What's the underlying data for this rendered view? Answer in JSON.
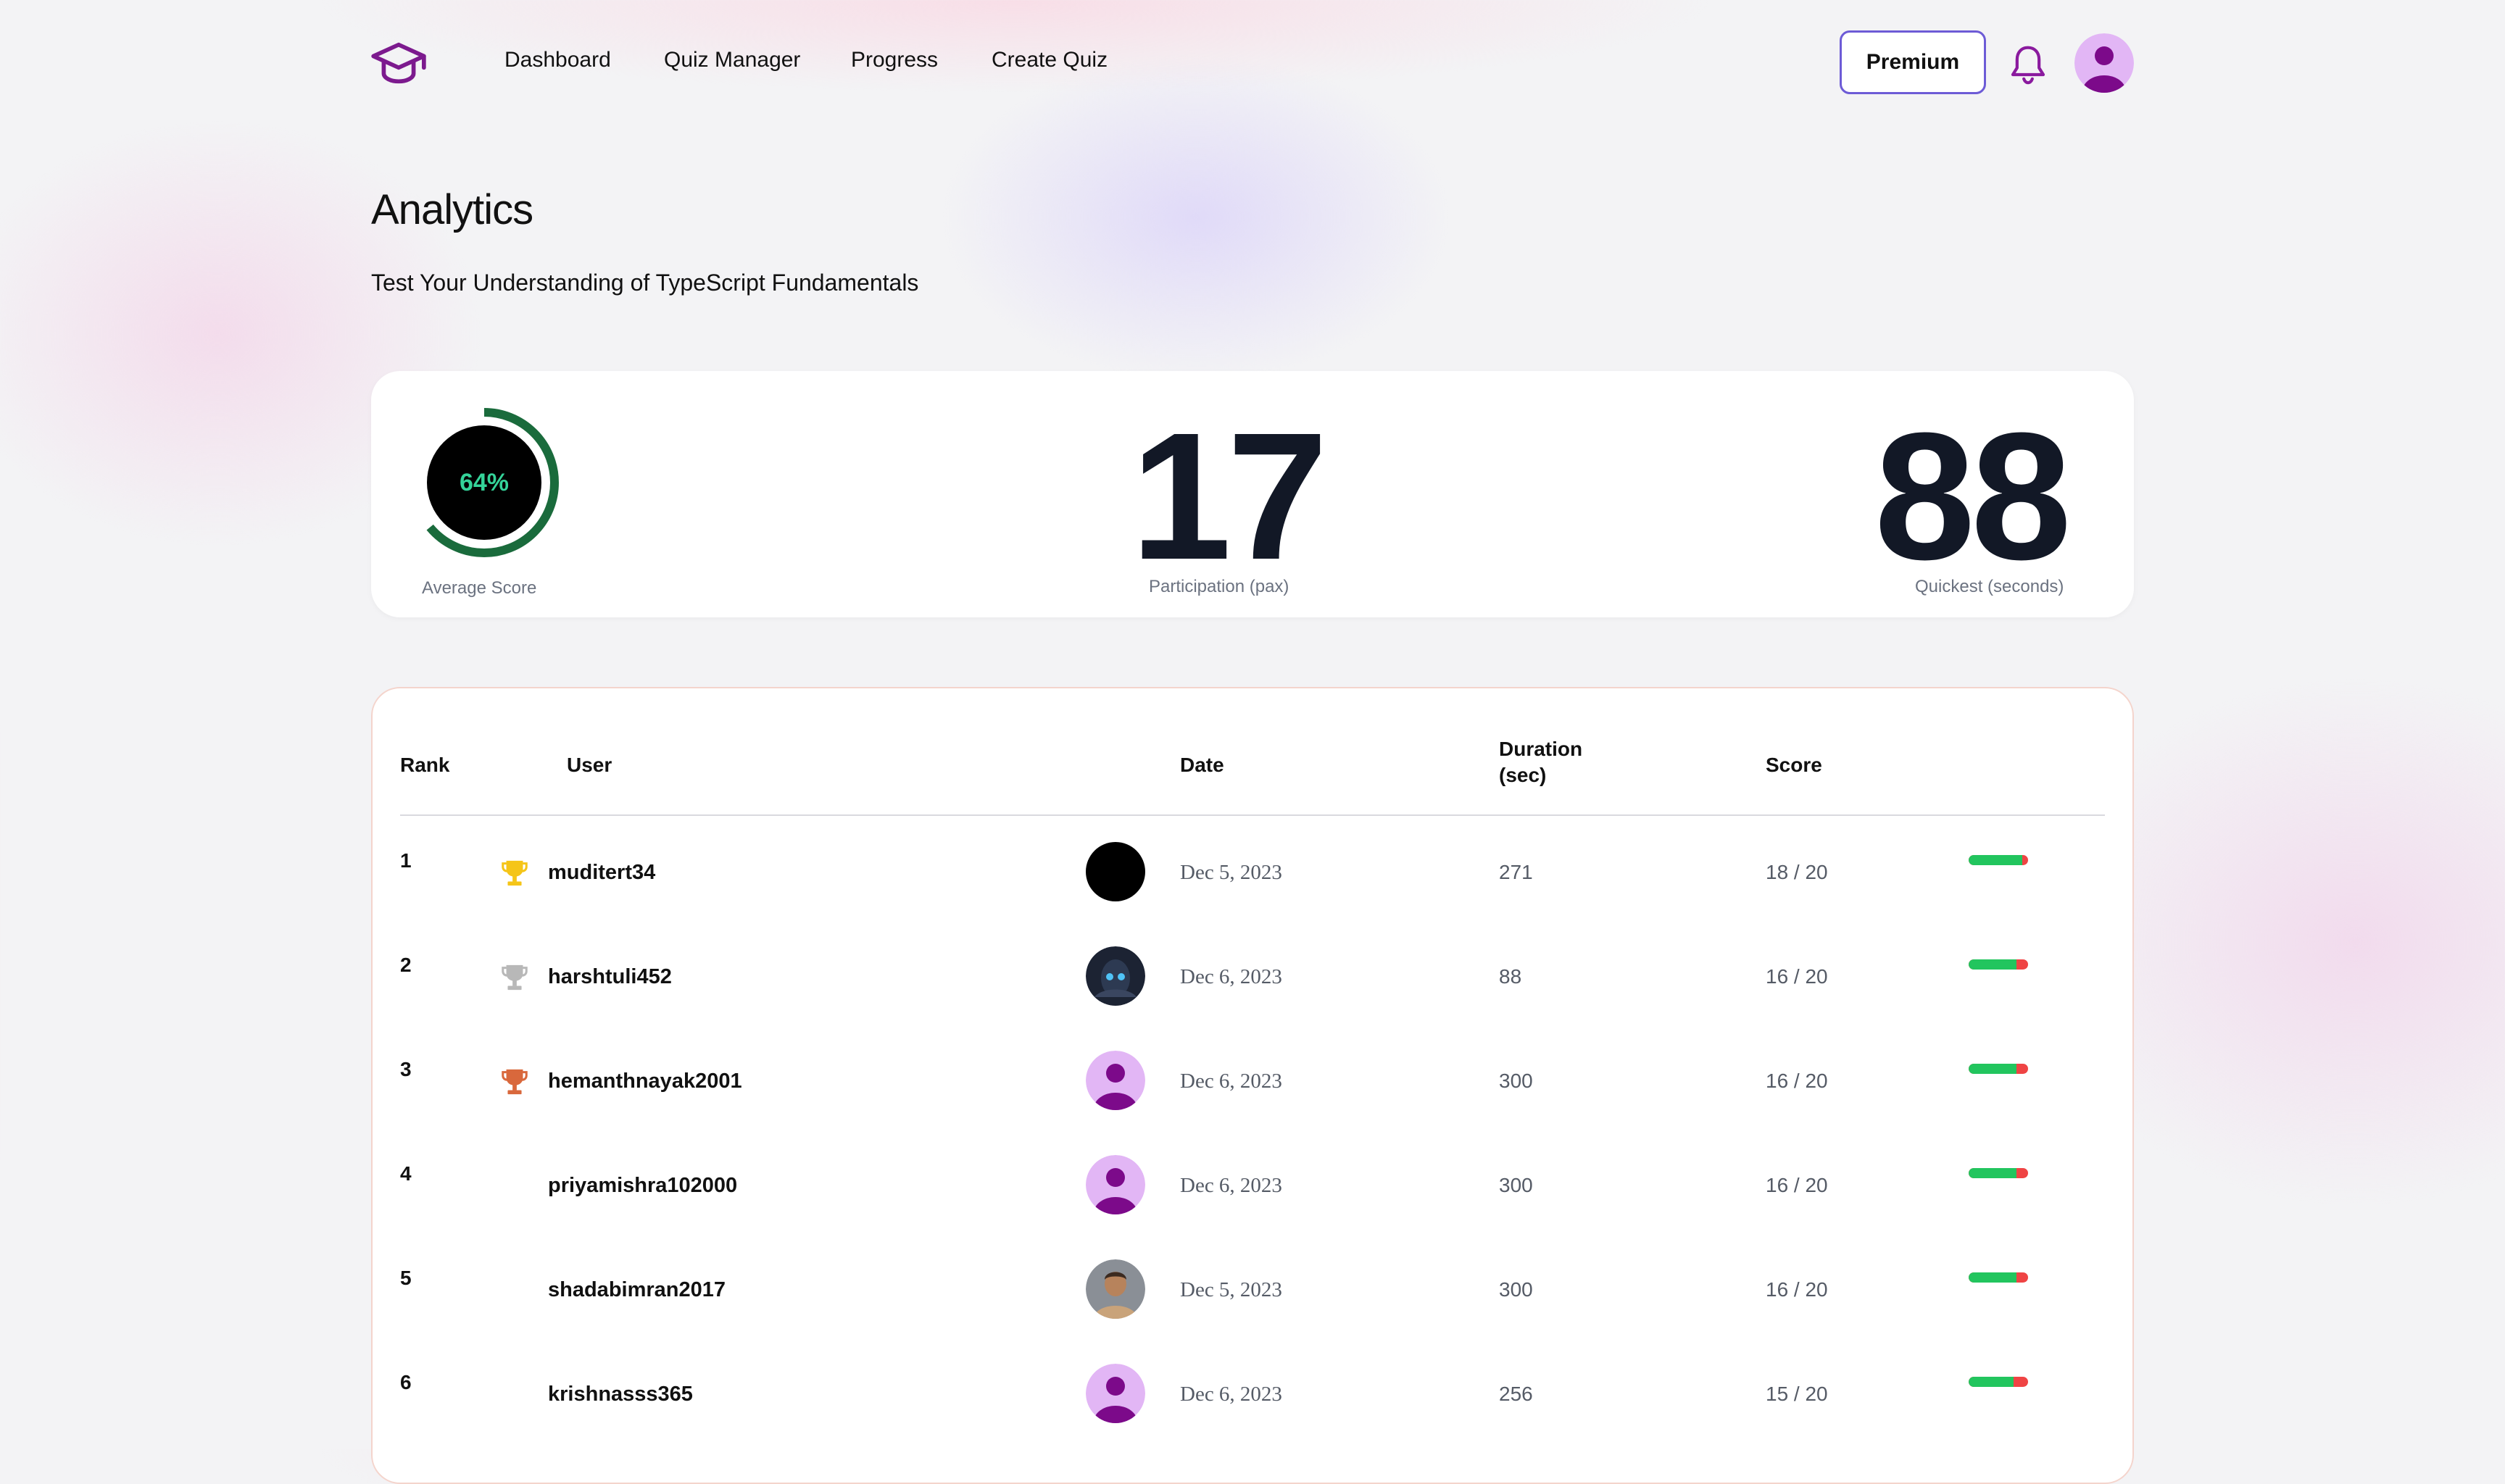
{
  "header": {
    "nav": [
      "Dashboard",
      "Quiz Manager",
      "Progress",
      "Create Quiz"
    ],
    "premium_label": "Premium"
  },
  "page": {
    "title": "Analytics",
    "subtitle": "Test Your Understanding of TypeScript Fundamentals"
  },
  "stats": {
    "average_score_value": 0.64,
    "average_score_text": "64%",
    "average_score_label": "Average Score",
    "participation": "17",
    "participation_label": "Participation (pax)",
    "quickest": "88",
    "quickest_label": "Quickest (seconds)"
  },
  "colors": {
    "accent": "#6d5bd6",
    "gauge_ring": "#1a6b3c",
    "gauge_text": "#34d399",
    "bar_green": "#22c55e",
    "bar_red": "#ef4444",
    "trophy_gold": "#f5c518",
    "trophy_silver": "#b8b8b8",
    "trophy_bronze": "#d9683c",
    "avatar_bg": "#e2b6f5",
    "avatar_fg": "#7c0a8a"
  },
  "table": {
    "headers": {
      "rank": "Rank",
      "user": "User",
      "date": "Date",
      "duration_line1": "Duration",
      "duration_line2": "(sec)",
      "score": "Score"
    },
    "rows": [
      {
        "rank": "1",
        "trophy": "gold-trophy-icon",
        "user": "muditert34",
        "avatar": "black-avatar",
        "date": "Dec 5, 2023",
        "duration": "271",
        "score": "18 / 20",
        "score_fraction": 0.9
      },
      {
        "rank": "2",
        "trophy": "silver-trophy-icon",
        "user": "harshtuli452",
        "avatar": "photo-avatar",
        "date": "Dec 6, 2023",
        "duration": "88",
        "score": "16 / 20",
        "score_fraction": 0.8
      },
      {
        "rank": "3",
        "trophy": "bronze-trophy-icon",
        "user": "hemanthnayak2001",
        "avatar": "default-avatar",
        "date": "Dec 6, 2023",
        "duration": "300",
        "score": "16 / 20",
        "score_fraction": 0.8
      },
      {
        "rank": "4",
        "trophy": "",
        "user": "priyamishra102000",
        "avatar": "default-avatar",
        "date": "Dec 6, 2023",
        "duration": "300",
        "score": "16 / 20",
        "score_fraction": 0.8
      },
      {
        "rank": "5",
        "trophy": "",
        "user": "shadabimran2017",
        "avatar": "photo-avatar",
        "date": "Dec 5, 2023",
        "duration": "300",
        "score": "16 / 20",
        "score_fraction": 0.8
      },
      {
        "rank": "6",
        "trophy": "",
        "user": "krishnasss365",
        "avatar": "default-avatar",
        "date": "Dec 6, 2023",
        "duration": "256",
        "score": "15 / 20",
        "score_fraction": 0.75
      }
    ]
  }
}
